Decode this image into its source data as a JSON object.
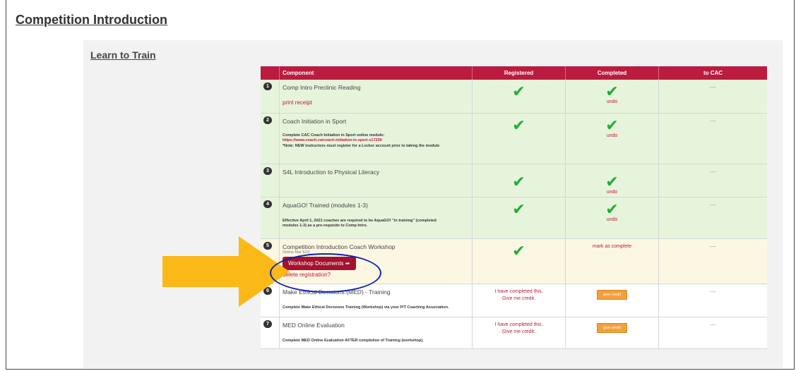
{
  "page": {
    "title": "Competition Introduction"
  },
  "section": {
    "title": "Learn to Train"
  },
  "table": {
    "headers": [
      "",
      "Component",
      "Registered",
      "Completed",
      "to CAC"
    ],
    "rows": [
      {
        "num": "1",
        "component": "Comp Intro Preclinic Reading",
        "link": "print receipt",
        "completed_action": "undo",
        "to_cac": "—"
      },
      {
        "num": "2",
        "component": "Coach Initiation in Sport",
        "note_line1": "Complete CAC Coach Initiation in Sport online module:",
        "note_url": "https://www.coach.ca/coach-initiation-in-sport-s17259",
        "note_line3": "*Note: NEW instructors must register for a Locker account prior to taking the module",
        "completed_action": "undo",
        "to_cac": "—"
      },
      {
        "num": "3",
        "component": "S4L Introduction to Physical Literacy",
        "completed_action": "undo",
        "to_cac": "—"
      },
      {
        "num": "4",
        "component": "AquaGO! Trained (modules 1-3)",
        "note_line1": "Effective April 1, 2021 coaches are required to be AquaGO! \"in training\" (completed",
        "note_line2": "modules 1-3) as a pre-requisite to Comp Intro.",
        "completed_action": "undo",
        "to_cac": "—"
      },
      {
        "num": "5",
        "component": "Competition Introduction Coach Workshop",
        "date": "Online Mar 5/21",
        "button": "Workshop Documents",
        "link": "delete registration?",
        "completed_action": "mark as complete",
        "to_cac": "—"
      },
      {
        "num": "6",
        "component": "Make Ethical Decisions (MED) - Training",
        "note_line1": "Complete Make Ethical Decisions Training (Workshop) via your P/T Coaching Association.",
        "registered_line1": "I have completed this.",
        "registered_line2": "Give me credit.",
        "completed_button": "give credit",
        "to_cac": "—"
      },
      {
        "num": "7",
        "component": "MED Online Evaluation",
        "note_line1": "Complete MED Online Evaluation AFTER completion of Training (workshop).",
        "registered_line1": "I have completed this.",
        "registered_line2": "Give me credit.",
        "completed_button": "give credit",
        "to_cac": "—"
      }
    ]
  },
  "colors": {
    "header": "#bb1b3e",
    "check": "#1fae35",
    "arrow": "#fbb917",
    "circle": "#0b1fb5"
  },
  "icons": {
    "check": "checkmark-icon",
    "share": "share-arrow-icon",
    "annotation_arrow": "right-arrow-icon"
  }
}
